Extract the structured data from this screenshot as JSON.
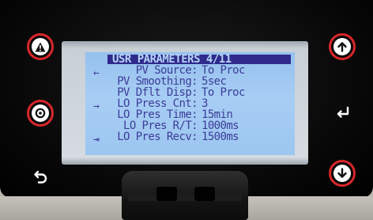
{
  "display": {
    "header": "USR PARAMETERS 4/11",
    "rows": [
      {
        "label": "PV Source:",
        "value": "To Proc"
      },
      {
        "label": "PV Smoothing:",
        "value": "5sec"
      },
      {
        "label": "PV Dflt Disp:",
        "value": "To Proc"
      },
      {
        "label": "LO Press Cnt:",
        "value": "3"
      },
      {
        "label": "LO Pres Time:",
        "value": "15min"
      },
      {
        "label": "LO Pres R/T:",
        "value": "1000ms"
      },
      {
        "label": "LO Pres Recv:",
        "value": "1500ms"
      }
    ],
    "side_icons": [
      {
        "name": "back-arrow-icon",
        "glyph": "←"
      },
      {
        "name": "enter-arrow-icon",
        "glyph": "→"
      },
      {
        "name": "exit-icon",
        "glyph": "⇥"
      }
    ]
  },
  "buttons": {
    "alarm": {
      "icon": "warning-triangle-icon"
    },
    "select": {
      "icon": "target-ring-icon"
    },
    "back": {
      "icon": "undo-arrow-icon"
    },
    "up": {
      "icon": "arrow-up-icon"
    },
    "enter": {
      "icon": "enter-return-icon"
    },
    "down": {
      "icon": "arrow-down-icon"
    }
  },
  "colors": {
    "button_ring": "#d9262b",
    "lcd_background": "#a7cdf4",
    "lcd_text": "#3c3c98",
    "header_background": "#2f2a8c"
  }
}
